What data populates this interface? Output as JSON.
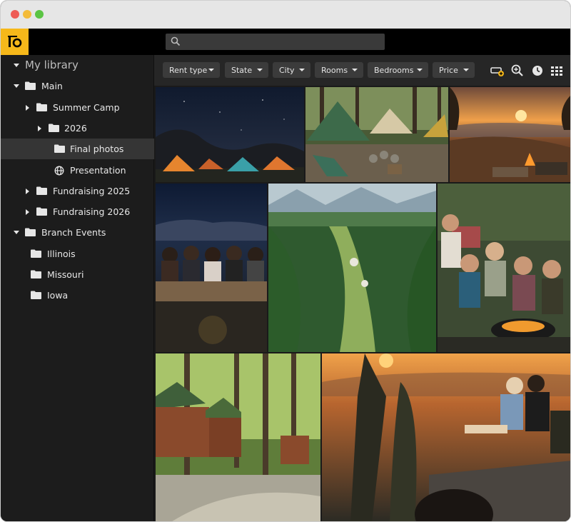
{
  "window": {
    "controls": [
      "close",
      "minimize",
      "maximize"
    ]
  },
  "appbar": {
    "logo_text": "iO",
    "search": {
      "placeholder": "",
      "value": ""
    }
  },
  "sidebar": {
    "root": {
      "label": "My library",
      "expanded": true
    },
    "items": [
      {
        "label": "Main",
        "type": "folder",
        "expanded": true
      },
      {
        "label": "Summer Camp",
        "type": "folder",
        "expanded": false
      },
      {
        "label": "2026",
        "type": "folder",
        "expanded": false
      },
      {
        "label": "Final photos",
        "type": "folder",
        "selected": true
      },
      {
        "label": "Presentation",
        "type": "globe"
      },
      {
        "label": "Fundraising 2025",
        "type": "folder",
        "expanded": false
      },
      {
        "label": "Fundraising 2026",
        "type": "folder",
        "expanded": false
      },
      {
        "label": "Branch Events",
        "type": "folder",
        "expanded": true
      },
      {
        "label": "Illinois",
        "type": "folder"
      },
      {
        "label": "Missouri",
        "type": "folder"
      },
      {
        "label": "Iowa",
        "type": "folder"
      }
    ]
  },
  "filters": [
    {
      "label": "Rent type"
    },
    {
      "label": "State"
    },
    {
      "label": "City"
    },
    {
      "label": "Rooms"
    },
    {
      "label": "Bedrooms"
    },
    {
      "label": "Price"
    }
  ],
  "toolbar_icons": [
    "add-storage-icon",
    "zoom-in-icon",
    "history-icon",
    "grid-view-icon"
  ],
  "photos": [
    {
      "subject": "tents-under-night-sky"
    },
    {
      "subject": "campsite-in-forest"
    },
    {
      "subject": "sunset-campfire-overlook"
    },
    {
      "subject": "friends-at-night-fence"
    },
    {
      "subject": "aerial-valley-forest"
    },
    {
      "subject": "friends-roasting-marshmallows"
    },
    {
      "subject": "log-cabins-in-woods"
    },
    {
      "subject": "friends-sunset-cliff"
    }
  ],
  "colors": {
    "accent": "#f6b81a",
    "sidebar_bg": "#1c1c1c",
    "selected_row": "#353535",
    "chip_bg": "#3b3b3b"
  }
}
